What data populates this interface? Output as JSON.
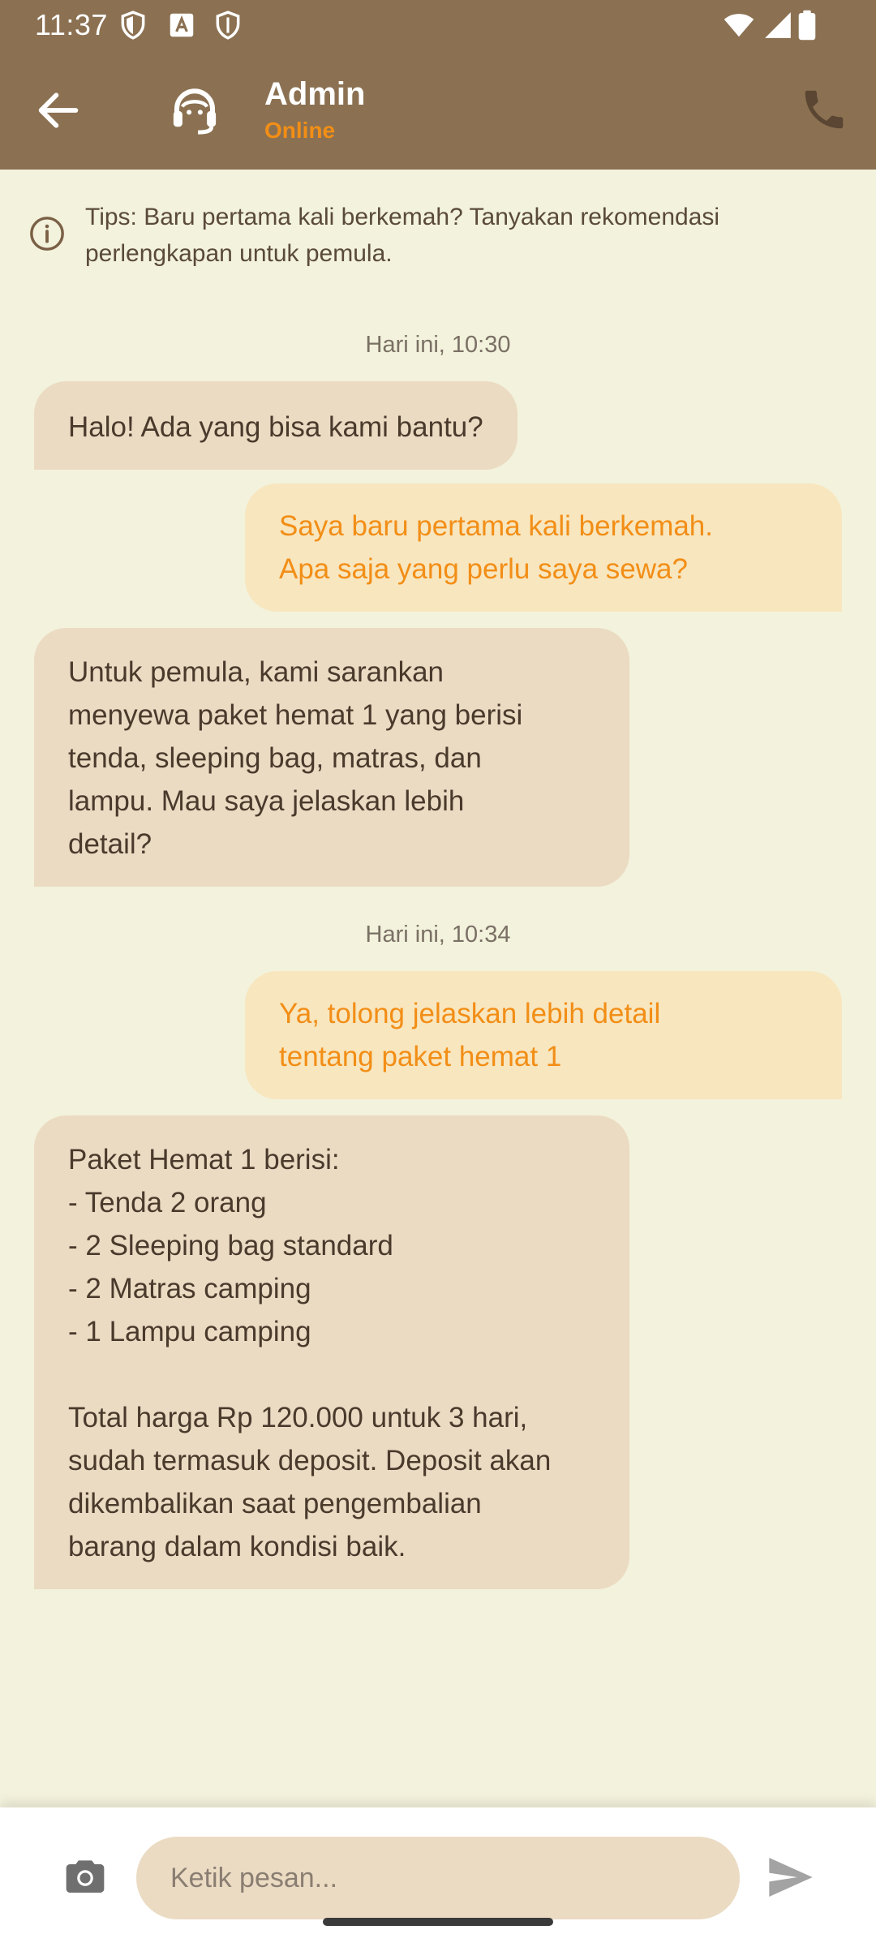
{
  "status_bar": {
    "time": "11:37",
    "icons": [
      "shield-icon",
      "font-app-icon",
      "shield-outline-icon",
      "wifi-icon",
      "signal-icon",
      "battery-icon"
    ]
  },
  "header": {
    "name": "Admin",
    "status": "Online",
    "icons": [
      "back-arrow-icon",
      "headset-agent-icon",
      "phone-icon"
    ]
  },
  "tips": {
    "text": "Tips: Baru pertama kali berkemah? Tanyakan rekomendasi perlengkapan untuk pemula.",
    "icon": "info-icon"
  },
  "chat": {
    "groups": [
      {
        "time": "Hari ini, 10:30"
      },
      {
        "time": "Hari ini, 10:34"
      }
    ],
    "messages": [
      {
        "from": "admin",
        "text": "Halo! Ada yang bisa kami bantu?"
      },
      {
        "from": "user",
        "text": "Saya baru pertama kali berkemah.\nApa saja yang perlu saya sewa?"
      },
      {
        "from": "admin",
        "text": "Untuk pemula, kami sarankan\nmenyewa paket hemat 1 yang berisi\ntenda, sleeping bag, matras, dan\nlampu. Mau saya jelaskan lebih\ndetail?"
      },
      {
        "from": "user",
        "text": "Ya, tolong jelaskan lebih detail\ntentang paket hemat 1"
      },
      {
        "from": "admin",
        "text": "Paket Hemat 1 berisi:\n- Tenda 2 orang\n- 2 Sleeping bag standard\n- 2 Matras camping\n- 1 Lampu camping\n\nTotal harga Rp 120.000 untuk 3 hari,\nsudah termasuk deposit. Deposit akan\ndikembalikan saat pengembalian\nbarang dalam kondisi baik."
      }
    ]
  },
  "input": {
    "placeholder": "Ketik pesan...",
    "value": "",
    "icons": [
      "camera-icon",
      "send-icon"
    ]
  },
  "colors": {
    "app_bar": "#8B7152",
    "background": "#F3F2DC",
    "accent_orange": "#F28E16",
    "incoming_bubble": "#EBDBC3",
    "outgoing_bubble": "#F8E6BF"
  }
}
